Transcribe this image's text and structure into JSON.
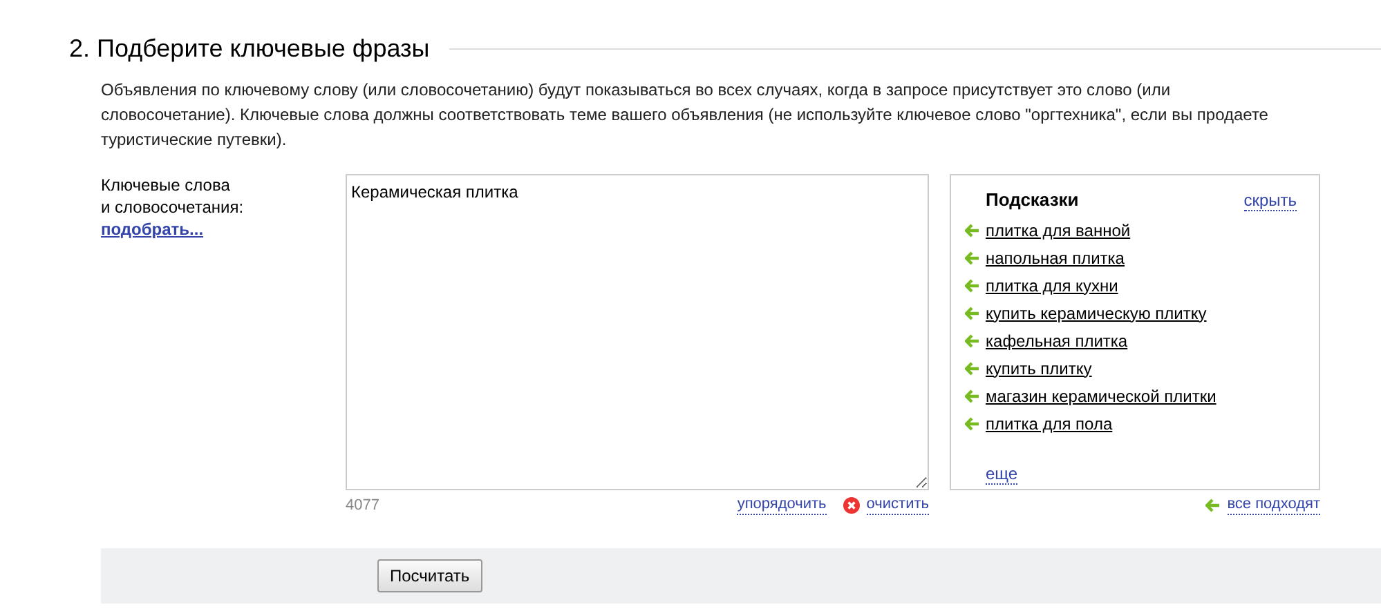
{
  "section": {
    "title": "2. Подберите ключевые фразы",
    "description": "Объявления по ключевому слову (или словосочетанию) будут показываться во всех случаях, когда в запросе присутствует это слово (или словосочетание). Ключевые слова должны соответствовать теме вашего объявления (не используйте ключевое слово \"оргтехника\", если вы продаете туристические путевки)."
  },
  "keywords": {
    "label_lines": [
      "Ключевые слова",
      "и словосочетания:"
    ],
    "pick_link": "подобрать...",
    "value": "Керамическая плитка",
    "counter": "4077",
    "sort_link": "упорядочить",
    "clear_link": "очистить"
  },
  "hints": {
    "title": "Подсказки",
    "hide_link": "скрыть",
    "items": [
      {
        "text": "плитка для ванной"
      },
      {
        "text": "напольная плитка"
      },
      {
        "text": "плитка для кухни"
      },
      {
        "text": "купить керамическую плитку"
      },
      {
        "text": "кафельная плитка"
      },
      {
        "text": "купить плитку"
      },
      {
        "text": "магазин керамической плитки"
      },
      {
        "text": "плитка для пола"
      }
    ],
    "more_link": "еще",
    "all_link": "все подходят"
  },
  "buttons": [
    "Посчитать"
  ]
}
